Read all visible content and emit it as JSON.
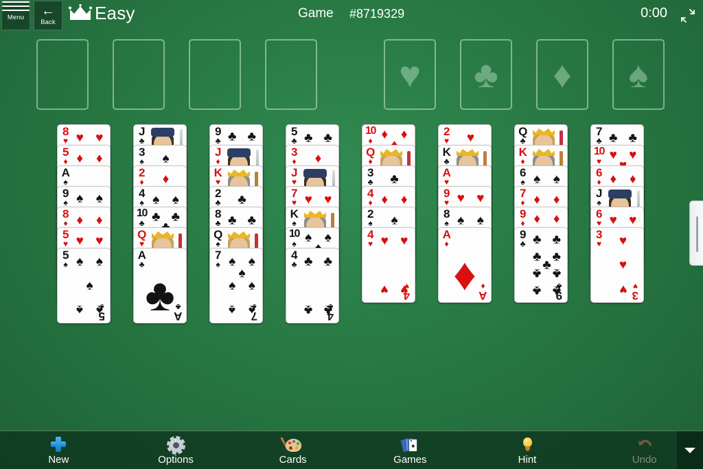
{
  "header": {
    "menu_label": "Menu",
    "back_label": "Back",
    "difficulty": "Easy",
    "game_label": "Game",
    "game_number": "#8719329",
    "timer": "0:00",
    "crown_icon": "crown-icon",
    "collapse_icon": "collapse-arrows-icon"
  },
  "free_cells": [
    {
      "name": "free-cell-1",
      "card": null
    },
    {
      "name": "free-cell-2",
      "card": null
    },
    {
      "name": "free-cell-3",
      "card": null
    },
    {
      "name": "free-cell-4",
      "card": null
    }
  ],
  "foundations": [
    {
      "name": "foundation-hearts",
      "suit": "hearts",
      "glyph": "♥",
      "card": null
    },
    {
      "name": "foundation-clubs",
      "suit": "clubs",
      "glyph": "♣",
      "card": null
    },
    {
      "name": "foundation-diamonds",
      "suit": "diamonds",
      "glyph": "♦",
      "card": null
    },
    {
      "name": "foundation-spades",
      "suit": "spades",
      "glyph": "♠",
      "card": null
    }
  ],
  "tableau": {
    "columns": [
      {
        "name": "tableau-column-1",
        "cards": [
          {
            "rank": "8",
            "suit": "hearts"
          },
          {
            "rank": "5",
            "suit": "diamonds"
          },
          {
            "rank": "A",
            "suit": "spades"
          },
          {
            "rank": "9",
            "suit": "spades"
          },
          {
            "rank": "8",
            "suit": "diamonds"
          },
          {
            "rank": "5",
            "suit": "hearts"
          },
          {
            "rank": "5",
            "suit": "spades"
          }
        ]
      },
      {
        "name": "tableau-column-2",
        "cards": [
          {
            "rank": "J",
            "suit": "clubs"
          },
          {
            "rank": "3",
            "suit": "spades"
          },
          {
            "rank": "2",
            "suit": "diamonds"
          },
          {
            "rank": "4",
            "suit": "spades"
          },
          {
            "rank": "10",
            "suit": "clubs"
          },
          {
            "rank": "Q",
            "suit": "hearts"
          },
          {
            "rank": "A",
            "suit": "clubs"
          }
        ]
      },
      {
        "name": "tableau-column-3",
        "cards": [
          {
            "rank": "9",
            "suit": "clubs"
          },
          {
            "rank": "J",
            "suit": "diamonds"
          },
          {
            "rank": "K",
            "suit": "hearts"
          },
          {
            "rank": "2",
            "suit": "clubs"
          },
          {
            "rank": "8",
            "suit": "clubs"
          },
          {
            "rank": "Q",
            "suit": "spades"
          },
          {
            "rank": "7",
            "suit": "spades"
          }
        ]
      },
      {
        "name": "tableau-column-4",
        "cards": [
          {
            "rank": "5",
            "suit": "clubs"
          },
          {
            "rank": "3",
            "suit": "diamonds"
          },
          {
            "rank": "J",
            "suit": "hearts"
          },
          {
            "rank": "7",
            "suit": "hearts"
          },
          {
            "rank": "K",
            "suit": "spades"
          },
          {
            "rank": "10",
            "suit": "spades"
          },
          {
            "rank": "4",
            "suit": "clubs"
          }
        ]
      },
      {
        "name": "tableau-column-5",
        "cards": [
          {
            "rank": "10",
            "suit": "diamonds"
          },
          {
            "rank": "Q",
            "suit": "diamonds"
          },
          {
            "rank": "3",
            "suit": "clubs"
          },
          {
            "rank": "4",
            "suit": "diamonds"
          },
          {
            "rank": "2",
            "suit": "spades"
          },
          {
            "rank": "4",
            "suit": "hearts"
          }
        ]
      },
      {
        "name": "tableau-column-6",
        "cards": [
          {
            "rank": "2",
            "suit": "hearts"
          },
          {
            "rank": "K",
            "suit": "clubs"
          },
          {
            "rank": "A",
            "suit": "hearts"
          },
          {
            "rank": "9",
            "suit": "hearts"
          },
          {
            "rank": "8",
            "suit": "spades"
          },
          {
            "rank": "A",
            "suit": "diamonds"
          }
        ]
      },
      {
        "name": "tableau-column-7",
        "cards": [
          {
            "rank": "Q",
            "suit": "clubs"
          },
          {
            "rank": "K",
            "suit": "diamonds"
          },
          {
            "rank": "6",
            "suit": "spades"
          },
          {
            "rank": "7",
            "suit": "diamonds"
          },
          {
            "rank": "9",
            "suit": "diamonds"
          },
          {
            "rank": "9",
            "suit": "clubs"
          }
        ]
      },
      {
        "name": "tableau-column-8",
        "cards": [
          {
            "rank": "7",
            "suit": "clubs"
          },
          {
            "rank": "10",
            "suit": "hearts"
          },
          {
            "rank": "6",
            "suit": "diamonds"
          },
          {
            "rank": "J",
            "suit": "spades"
          },
          {
            "rank": "6",
            "suit": "hearts"
          },
          {
            "rank": "3",
            "suit": "hearts"
          }
        ]
      }
    ]
  },
  "toolbar": {
    "items": [
      {
        "name": "toolbar-new",
        "label": "New",
        "icon": "plus-icon",
        "disabled": false
      },
      {
        "name": "toolbar-options",
        "label": "Options",
        "icon": "gear-icon",
        "disabled": false
      },
      {
        "name": "toolbar-cards",
        "label": "Cards",
        "icon": "palette-icon",
        "disabled": false
      },
      {
        "name": "toolbar-games",
        "label": "Games",
        "icon": "cards-icon",
        "disabled": false
      },
      {
        "name": "toolbar-hint",
        "label": "Hint",
        "icon": "lightbulb-icon",
        "disabled": false
      },
      {
        "name": "toolbar-undo",
        "label": "Undo",
        "icon": "undo-icon",
        "disabled": true
      }
    ],
    "caret_icon": "chevron-down-icon"
  },
  "drawer": {
    "name": "side-drawer-handle",
    "icon": "grip-handle-icon"
  },
  "colors": {
    "felt": "#2a8a4e",
    "red_suit": "#d81010",
    "black_suit": "#131313",
    "header_bg": "#123a22"
  },
  "suit_glyphs": {
    "hearts": "♥",
    "diamonds": "♦",
    "clubs": "♣",
    "spades": "♠"
  }
}
